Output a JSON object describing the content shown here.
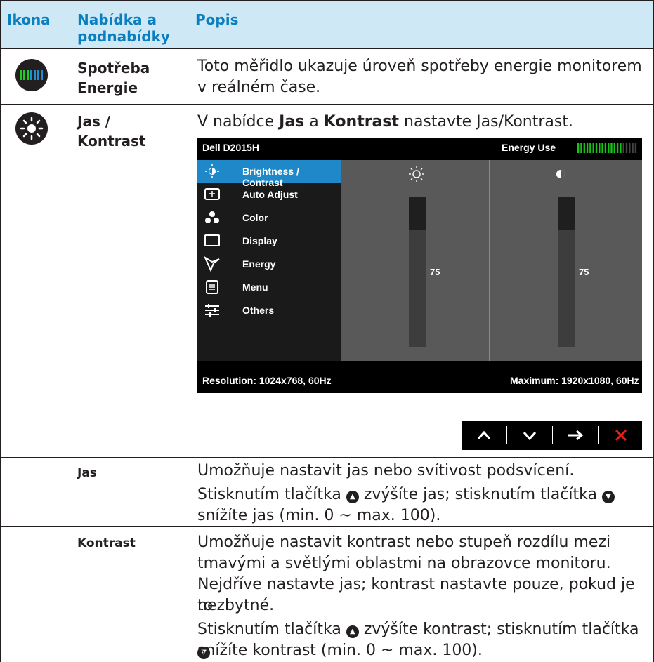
{
  "header": {
    "icon": "Ikona",
    "menu": "Nabídka a\npodnabídky",
    "desc": "Popis"
  },
  "rows": {
    "energy": {
      "icon": "energy-meter-icon",
      "menu_line1": "Spotřeba",
      "menu_line2": "Energie",
      "desc_line1": "Toto měřidlo ukazuje úroveň spotřeby energie monitorem",
      "desc_line2": "v reálném čase."
    },
    "brightness": {
      "icon": "brightness-sun-icon",
      "menu_line1": "Jas /",
      "menu_line2": "Kontrast",
      "desc_pre": "V nabídce ",
      "desc_b1": "Jas",
      "desc_mid": " a ",
      "desc_b2": "Kontrast",
      "desc_post": " nastavte Jas/Kontrast."
    },
    "jas": {
      "label": "Jas",
      "line1": "Umožňuje nastavit jas nebo svítivost podsvícení.",
      "line2a": "Stisknutím tlačítka ",
      "line2b": " zvýšíte jas; stisknutím tlačítka ",
      "line3": "snížíte jas (min. 0 ~ max. 100)."
    },
    "kontrast": {
      "label": "Kontrast",
      "line1": "Umožňuje nastavit kontrast nebo stupeň rozdílu mezi",
      "line2": "tmavými a světlými oblastmi na obrazovce monitoru.",
      "line3": "Nejdříve nastavte jas; kontrast nastavte pouze, pokud je to",
      "line4": "nezbytné.",
      "line5a": "Stisknutím tlačítka ",
      "line5b": " zvýšíte kontrast; stisknutím tlačítka ",
      "line6": "snížíte kontrast (min. 0 ~ max. 100)."
    }
  },
  "osd": {
    "model": "Dell D2015H",
    "energy_label": "Energy Use",
    "energy_level": 0.75,
    "menu": [
      {
        "label": "Brightness / Contrast",
        "icon": "brightness-icon",
        "selected": true
      },
      {
        "label": "Auto Adjust",
        "icon": "auto-adjust-icon",
        "selected": false
      },
      {
        "label": "Color",
        "icon": "color-icon",
        "selected": false
      },
      {
        "label": "Display",
        "icon": "display-icon",
        "selected": false
      },
      {
        "label": "Energy",
        "icon": "energy-leaf-icon",
        "selected": false
      },
      {
        "label": "Menu",
        "icon": "menu-icon",
        "selected": false
      },
      {
        "label": "Others",
        "icon": "others-icon",
        "selected": false
      }
    ],
    "brightness_value": "75",
    "contrast_value": "75",
    "resolution": "Resolution: 1024x768, 60Hz",
    "maximum": "Maximum: 1920x1080, 60Hz"
  },
  "nav_buttons": [
    "up",
    "down",
    "enter",
    "exit"
  ],
  "colors": {
    "header_bg": "#cfe8f6",
    "header_text": "#0a7fc0",
    "osd_select": "#1e88c8",
    "exit_red": "#e32119",
    "meter_green": "#19c219"
  }
}
